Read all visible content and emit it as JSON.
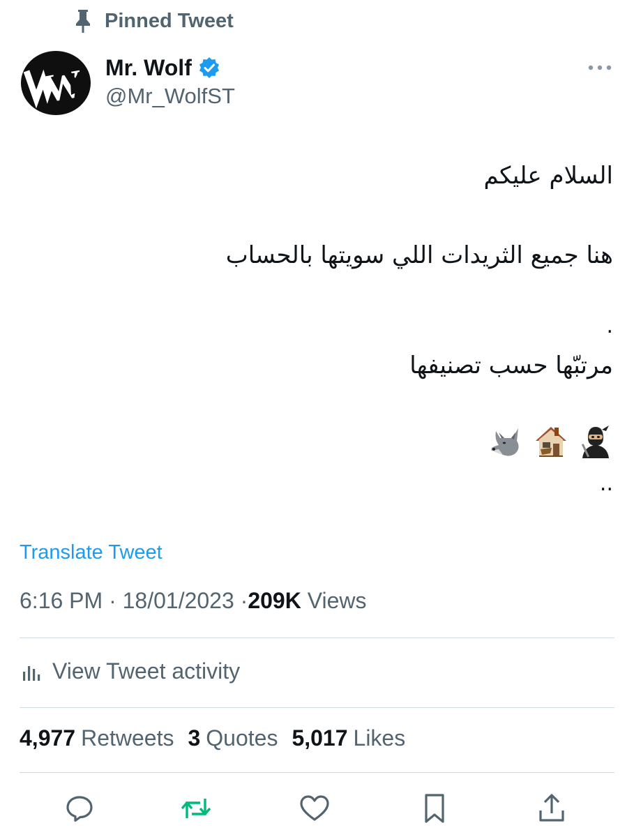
{
  "pinned": {
    "label": "Pinned Tweet"
  },
  "author": {
    "display_name": "Mr. Wolf",
    "handle": "@Mr_WolfST",
    "avatar_letter": "W",
    "verified": true
  },
  "tweet": {
    "lines": [
      "السلام عليكم",
      "هنا جميع الثريدات اللي سويتها بالحساب",
      ".",
      "مرتبّها حسب تصنيفها",
      ".."
    ],
    "emoji_icons": [
      "ninja-emoji-icon",
      "house-emoji-icon",
      "wolf-emoji-icon"
    ],
    "translate_label": "Translate Tweet"
  },
  "meta": {
    "time": "6:16 PM",
    "separator": "·",
    "date": "18/01/2023",
    "views_count": "209K",
    "views_label": "Views"
  },
  "activity": {
    "label": "View Tweet activity"
  },
  "stats": {
    "retweets_count": "4,977",
    "retweets_label": "Retweets",
    "quotes_count": "3",
    "quotes_label": "Quotes",
    "likes_count": "5,017",
    "likes_label": "Likes"
  },
  "colors": {
    "link": "#1d9bf0",
    "verified": "#1d9bf0",
    "retweet_icon": "#00ba7c",
    "secondary_text": "#536471",
    "divider": "#cfd9de"
  }
}
